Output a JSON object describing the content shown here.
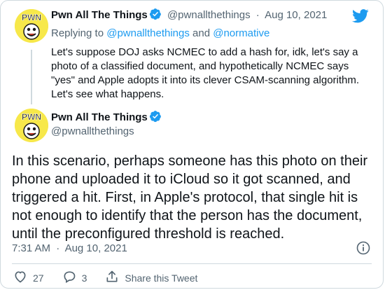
{
  "tweet1": {
    "name": "Pwn All The Things",
    "handle": "@pwnallthethings",
    "separator": "·",
    "date": "Aug 10, 2021",
    "reply_prefix": "Replying to ",
    "reply_user1": "@pwnallthethings",
    "reply_and": " and ",
    "reply_user2": "@normative",
    "body": "Let's suppose DOJ asks NCMEC to add a hash for, idk, let's say a photo of a classified document, and hypothetically NCMEC says \"yes\" and Apple adopts it into its clever CSAM-scanning algorithm. Let's see what happens."
  },
  "tweet2": {
    "name": "Pwn All The Things",
    "handle": "@pwnallthethings",
    "body": "In this scenario, perhaps someone has this photo on their phone and uploaded it to iCloud so it got scanned, and triggered a hit. First, in Apple's protocol, that single hit is not enough to identify that the person has the document, until the preconfigured threshold is reached.",
    "time": "7:31 AM",
    "separator": "·",
    "date": "Aug 10, 2021"
  },
  "actions": {
    "likes": "27",
    "replies": "3",
    "share_label": "Share this Tweet"
  },
  "avatar_text": "PWN",
  "icons": [
    "twitter-bird-icon",
    "verified-badge-icon",
    "info-icon",
    "heart-icon",
    "reply-icon",
    "share-icon"
  ],
  "colors": {
    "accent": "#1d9bf0",
    "muted": "#536471",
    "text": "#0f1419",
    "border": "#cfd9de",
    "avatar_bg": "#f7e84a"
  }
}
